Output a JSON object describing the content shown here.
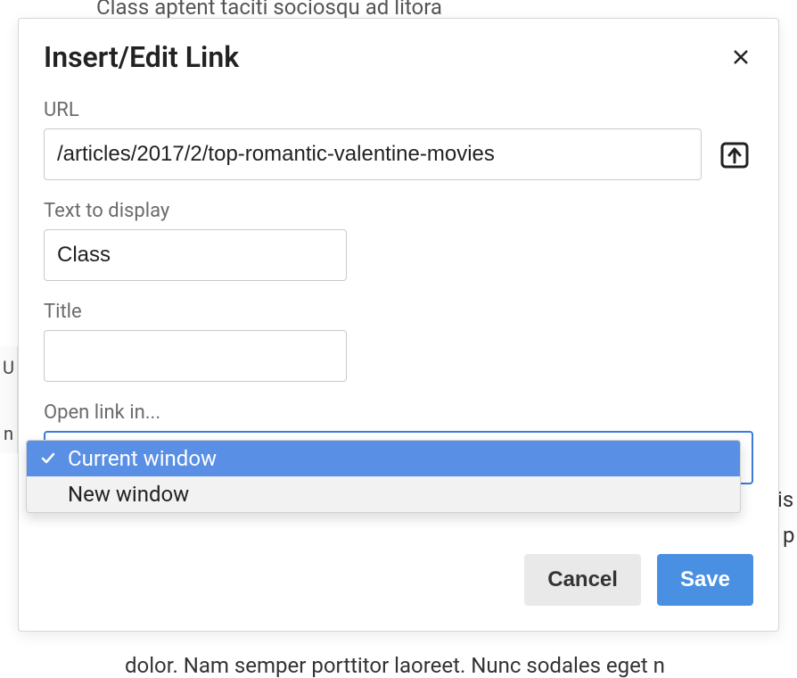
{
  "background": {
    "line_top": "Class aptent taciti sociosqu ad litora",
    "line_bottom": "dolor. Nam semper porttitor laoreet. Nunc sodales eget n",
    "right_frag1": "is",
    "right_frag2": "p",
    "sidebar_frag1": "U",
    "sidebar_frag2": "n"
  },
  "modal": {
    "title": "Insert/Edit Link",
    "fields": {
      "url": {
        "label": "URL",
        "value": "/articles/2017/2/top-romantic-valentine-movies"
      },
      "text": {
        "label": "Text to display",
        "value": "Class"
      },
      "title": {
        "label": "Title",
        "value": ""
      },
      "target": {
        "label": "Open link in...",
        "selected": "Current window",
        "options": [
          "Current window",
          "New window"
        ]
      }
    },
    "buttons": {
      "cancel": "Cancel",
      "save": "Save"
    }
  }
}
